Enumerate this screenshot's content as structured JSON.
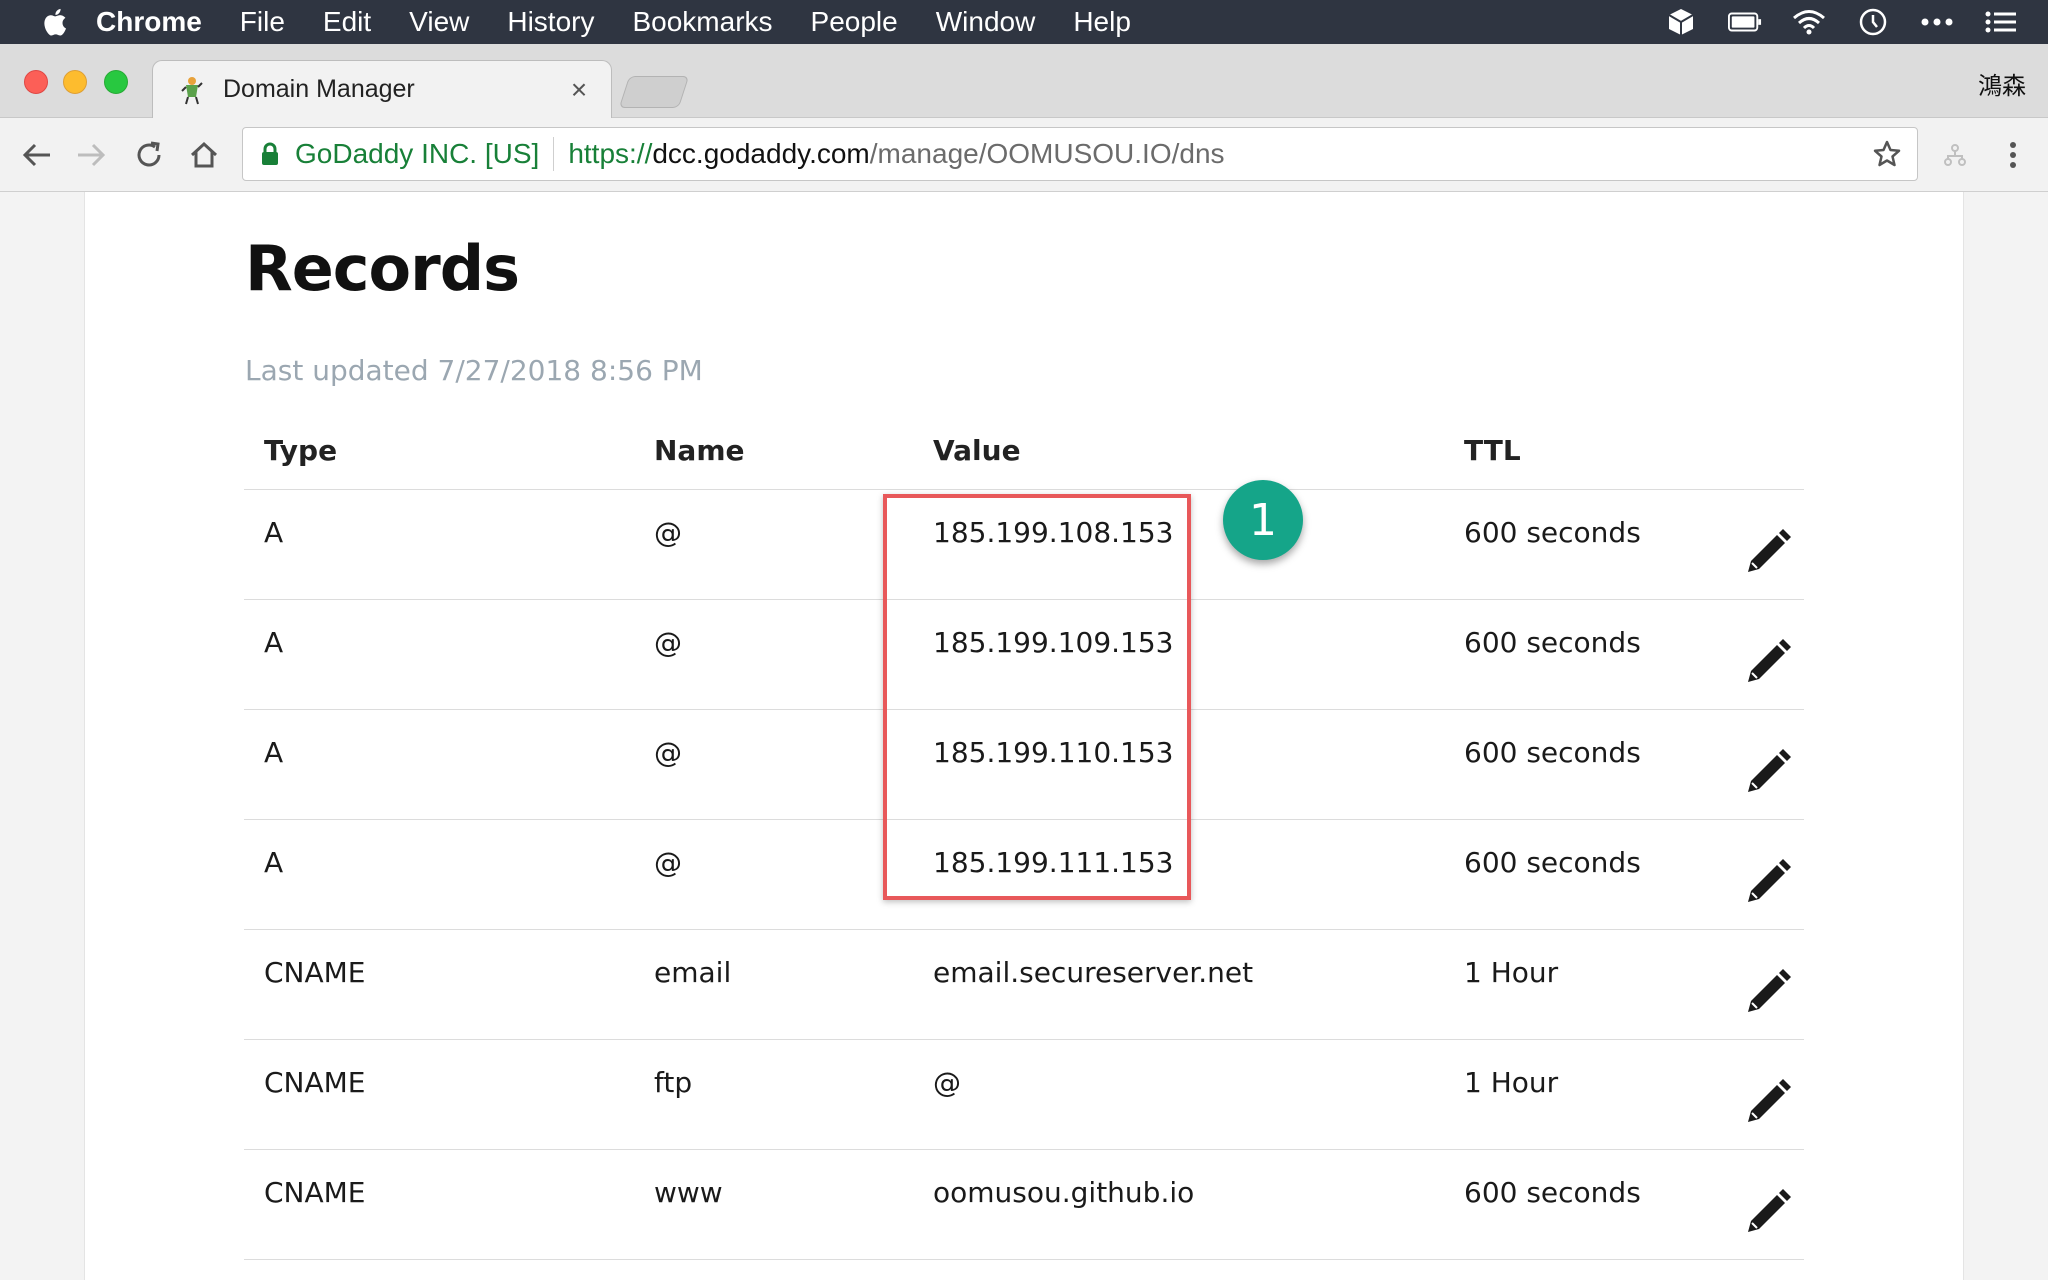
{
  "menubar": {
    "app_name": "Chrome",
    "items": [
      "File",
      "Edit",
      "View",
      "History",
      "Bookmarks",
      "People",
      "Window",
      "Help"
    ]
  },
  "tab": {
    "title": "Domain Manager",
    "close": "×"
  },
  "profile": {
    "name": "鴻森"
  },
  "address_bar": {
    "ev_label": "GoDaddy INC. [US]",
    "scheme": "https://",
    "host": "dcc.godaddy.com",
    "path": "/manage/OOMUSOU.IO/dns"
  },
  "page": {
    "title": "Records",
    "last_updated": "Last updated 7/27/2018 8:56 PM"
  },
  "table": {
    "headers": {
      "type": "Type",
      "name": "Name",
      "value": "Value",
      "ttl": "TTL"
    },
    "rows": [
      {
        "type": "A",
        "name": "@",
        "value": "185.199.108.153",
        "ttl": "600 seconds"
      },
      {
        "type": "A",
        "name": "@",
        "value": "185.199.109.153",
        "ttl": "600 seconds"
      },
      {
        "type": "A",
        "name": "@",
        "value": "185.199.110.153",
        "ttl": "600 seconds"
      },
      {
        "type": "A",
        "name": "@",
        "value": "185.199.111.153",
        "ttl": "600 seconds"
      },
      {
        "type": "CNAME",
        "name": "email",
        "value": "email.secureserver.net",
        "ttl": "1 Hour"
      },
      {
        "type": "CNAME",
        "name": "ftp",
        "value": "@",
        "ttl": "1 Hour"
      },
      {
        "type": "CNAME",
        "name": "www",
        "value": "oomusou.github.io",
        "ttl": "600 seconds"
      }
    ]
  },
  "annotation": {
    "badge": "1",
    "highlight_color": "#e8585a",
    "badge_color": "#15a589"
  },
  "icons": {
    "edit": "pencil-icon",
    "back": "back-arrow-icon",
    "forward": "forward-arrow-icon",
    "reload": "reload-icon",
    "home": "home-icon",
    "bookmark": "star-icon",
    "menu": "kebab-menu-icon"
  }
}
